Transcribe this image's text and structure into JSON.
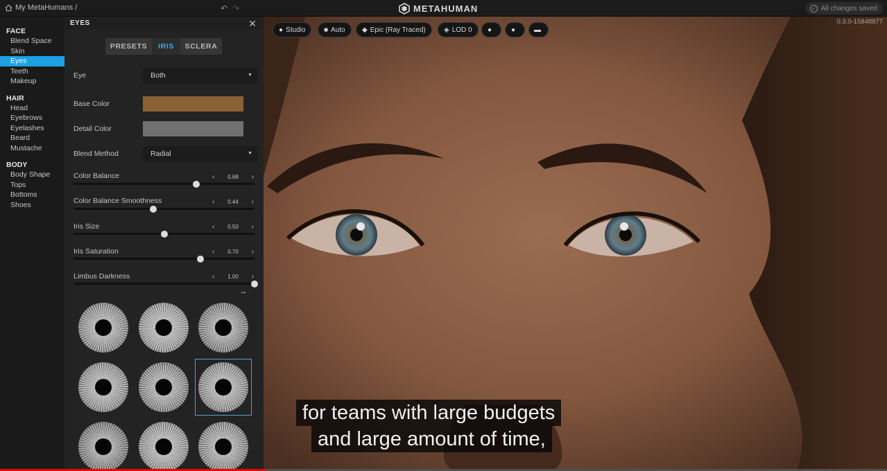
{
  "topbar": {
    "breadcrumb": "My MetaHumans /",
    "logo": "METAHUMAN",
    "status": "All changes saved"
  },
  "nav": {
    "face_header": "FACE",
    "face_items": [
      "Blend Space",
      "Skin",
      "Eyes",
      "Teeth",
      "Makeup"
    ],
    "hair_header": "HAIR",
    "hair_items": [
      "Head",
      "Eyebrows",
      "Eyelashes",
      "Beard",
      "Mustache"
    ],
    "body_header": "BODY",
    "body_items": [
      "Body Shape",
      "Tops",
      "Bottoms",
      "Shoes"
    ],
    "active": "Eyes"
  },
  "panel": {
    "title": "EYES",
    "tabs": [
      "PRESETS",
      "IRIS",
      "SCLERA"
    ],
    "active_tab": "IRIS",
    "eye_label": "Eye",
    "eye_value": "Both",
    "base_color_label": "Base Color",
    "base_color": "#8a6035",
    "detail_color_label": "Detail Color",
    "detail_color": "#707070",
    "blend_method_label": "Blend Method",
    "blend_method_value": "Radial",
    "sliders": [
      {
        "label": "Color Balance",
        "value": "0.68",
        "fraction": 0.68
      },
      {
        "label": "Color Balance Smoothness",
        "value": "0.44",
        "fraction": 0.44
      },
      {
        "label": "Iris Size",
        "value": "0.50",
        "fraction": 0.5
      },
      {
        "label": "Iris Saturation",
        "value": "0.70",
        "fraction": 0.7
      },
      {
        "label": "Limbus Darkness",
        "value": "1.00",
        "fraction": 1.0
      }
    ],
    "iris_presets_selected_index": 5
  },
  "viewport": {
    "buttons": [
      {
        "label": "Studio",
        "icon": "light-bulb-icon"
      },
      {
        "label": "Auto",
        "icon": "camera-icon"
      },
      {
        "label": "Epic (Ray Traced)",
        "icon": "diamond-icon"
      },
      {
        "label": "LOD 0",
        "icon": "layers-icon"
      }
    ],
    "icon_buttons": [
      "sphere-icon",
      "head-icon",
      "keyboard-icon"
    ],
    "version": "0.3.0-15848877",
    "subtitle_line1": "for teams with large budgets",
    "subtitle_line2": "and large amount of time,"
  },
  "video": {
    "progress_fraction": 0.3
  },
  "colors": {
    "accent": "#1ea1e3",
    "progress": "#e00b0b"
  }
}
